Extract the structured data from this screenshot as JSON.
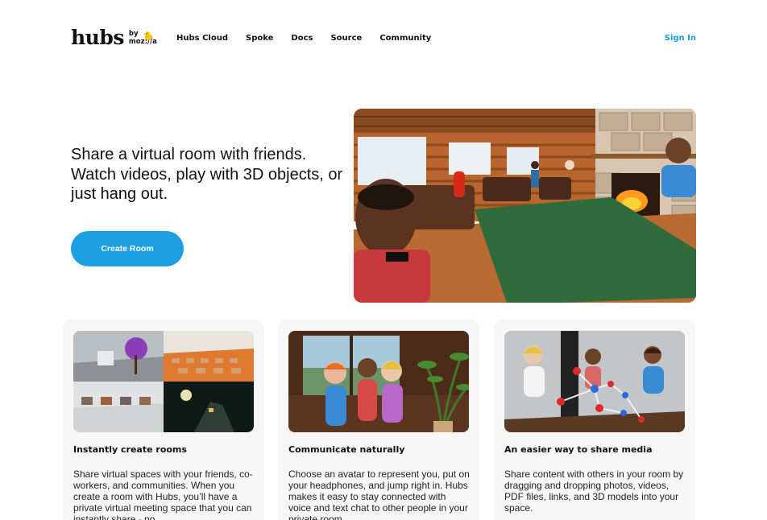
{
  "brand": {
    "name": "hubs",
    "by": "by",
    "org": "moz://a"
  },
  "nav": {
    "items": [
      "Hubs Cloud",
      "Spoke",
      "Docs",
      "Source",
      "Community"
    ],
    "sign_in": "Sign In"
  },
  "hero": {
    "text": "Share a virtual room with friends. Watch videos, play with 3D objects, or just hang out.",
    "cta": "Create Room",
    "image_icon": "virtual-lodge-room-image"
  },
  "cards": [
    {
      "title": "Instantly create rooms",
      "body": "Share virtual spaces with your friends, co-workers, and communities. When you create a room with Hubs, you’ll have a private virtual meeting space that you can instantly share - no",
      "image_icon": "room-collage-image"
    },
    {
      "title": "Communicate naturally",
      "body": "Choose an avatar to represent you, put on your headphones, and jump right in. Hubs makes it easy to stay connected with voice and text chat to other people in your private room.",
      "image_icon": "avatars-by-window-image"
    },
    {
      "title": "An easier way to share media",
      "body": "Share content with others in your room by dragging and dropping photos, videos, PDF files, links, and 3D models into your space.",
      "image_icon": "avatars-with-molecule-image"
    }
  ],
  "colors": {
    "accent": "#1ca0e3",
    "link": "#1a9ad9",
    "card_bg": "#f7f7f7"
  }
}
